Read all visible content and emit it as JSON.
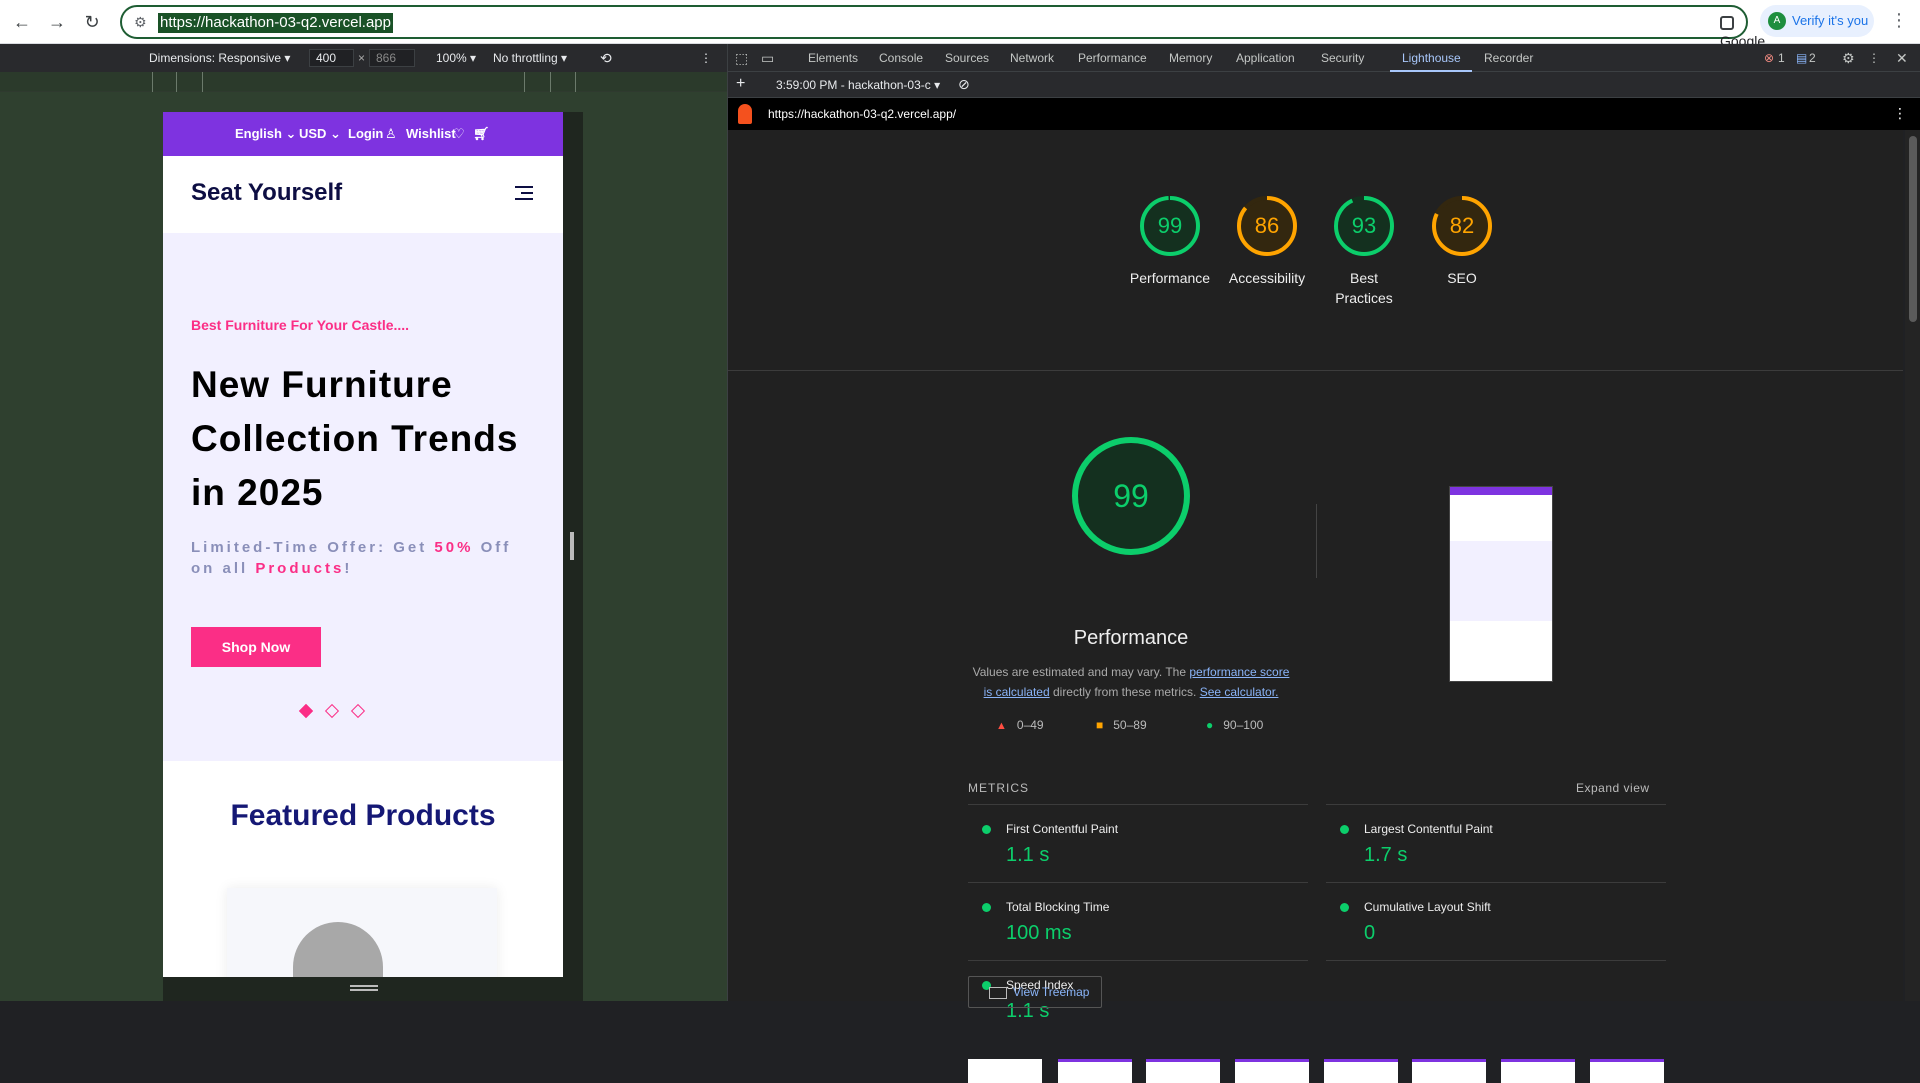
{
  "browser": {
    "url": "https://hackathon-03-q2.vercel.app",
    "lens_label": "Google Lens",
    "verify_label": "Verify it's you",
    "avatar_letter": "A"
  },
  "device_toolbar": {
    "dimensions_label": "Dimensions: Responsive ▾",
    "width": "400",
    "height": "866",
    "zoom": "100% ▾",
    "throttling": "No throttling ▾"
  },
  "site": {
    "topbar": {
      "language": "English ⌄",
      "currency": "USD ⌄",
      "login": "Login",
      "wishlist": "Wishlist"
    },
    "logo": "Seat Yourself",
    "kicker": "Best Furniture For Your Castle....",
    "headline": "New Furniture Collection Trends in 2025",
    "offer_prefix": "Limited-Time Offer: Get ",
    "offer_percent": "50%",
    "offer_mid": " Off on all ",
    "offer_products": "Products",
    "offer_suffix": "!",
    "cta": "Shop Now",
    "featured_title": "Featured Products",
    "carousel_active_index": 0
  },
  "devtools": {
    "tabs": [
      "Elements",
      "Console",
      "Sources",
      "Network",
      "Performance",
      "Memory",
      "Application",
      "Security",
      "Lighthouse",
      "Recorder"
    ],
    "active_tab": "Lighthouse",
    "error_count": "1",
    "message_count": "2",
    "report_selector": "3:59:00 PM - hackathon-03-c ▾",
    "report_url": "https://hackathon-03-q2.vercel.app/",
    "scores": [
      {
        "label": "Performance",
        "value": 99,
        "color": "#0cce6b"
      },
      {
        "label": "Accessibility",
        "value": 86,
        "color": "#ffa400"
      },
      {
        "label": "Best Practices",
        "value": 93,
        "color": "#0cce6b"
      },
      {
        "label": "SEO",
        "value": 82,
        "color": "#ffa400"
      }
    ],
    "performance": {
      "score": "99",
      "title": "Performance",
      "note_prefix": "Values are estimated and may vary. The ",
      "note_link1": "performance score is calculated",
      "note_mid": " directly from these metrics. ",
      "note_link2": "See calculator."
    },
    "legend": [
      {
        "range": "0–49",
        "color": "#ff4e42",
        "shape": "triangle"
      },
      {
        "range": "50–89",
        "color": "#ffa400",
        "shape": "square"
      },
      {
        "range": "90–100",
        "color": "#0cce6b",
        "shape": "circle"
      }
    ],
    "metrics_title": "METRICS",
    "expand_label": "Expand view",
    "metrics": [
      {
        "name": "First Contentful Paint",
        "value": "1.1 s"
      },
      {
        "name": "Largest Contentful Paint",
        "value": "1.7 s"
      },
      {
        "name": "Total Blocking Time",
        "value": "100 ms"
      },
      {
        "name": "Cumulative Layout Shift",
        "value": "0"
      },
      {
        "name": "Speed Index",
        "value": "1.1 s"
      }
    ],
    "treemap_label": "View Treemap"
  }
}
